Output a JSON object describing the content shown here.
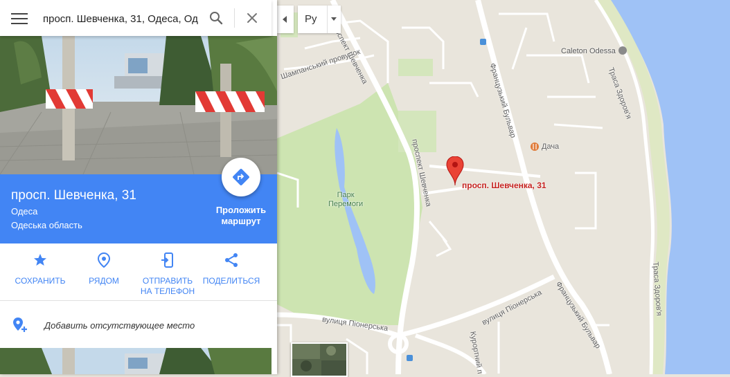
{
  "search": {
    "value": "просп. Шевченка, 31, Одеса, Од"
  },
  "place": {
    "title": "просп. Шевченка, 31",
    "city": "Одеса",
    "region": "Одеська область",
    "route_label": "Проложить маршрут"
  },
  "actions": [
    {
      "label": "СОХРАНИТЬ",
      "icon": "star-icon"
    },
    {
      "label": "РЯДОМ",
      "icon": "nearby-icon"
    },
    {
      "label": "ОТПРАВИТЬ НА ТЕЛЕФОН",
      "icon": "send-to-phone-icon"
    },
    {
      "label": "ПОДЕЛИТЬСЯ",
      "icon": "share-icon"
    }
  ],
  "add_place": {
    "label": "Добавить отсутствующее место"
  },
  "language": {
    "value": "Ру"
  },
  "map": {
    "pin_label": "просп. Шевченка, 31",
    "labels": {
      "shampanskiy": "Шампанський провулок",
      "prospekt_top": "проспект Шевченка",
      "prospekt_mid": "проспект Шевченка",
      "francuzkiy_top": "Французький Бульвар",
      "francuzkiy_bottom": "Французький Бульвар",
      "caleton": "Caleton Odessa",
      "trasa_top": "Траса Здоров'я",
      "trasa_bottom": "Траса Здоров'я",
      "dacha": "Дача",
      "park_line1": "Парк",
      "park_line2": "Перемоги",
      "pionerska_left": "вулиця Піонерська",
      "pionerska_right": "вулиця Піонерська",
      "kurortniy": "Курортний п"
    }
  },
  "colors": {
    "accent": "#4285f4",
    "pin": "#ea4335",
    "sea": "#9fc2f6",
    "park": "#cde4b1",
    "land": "#e9e5dc"
  }
}
